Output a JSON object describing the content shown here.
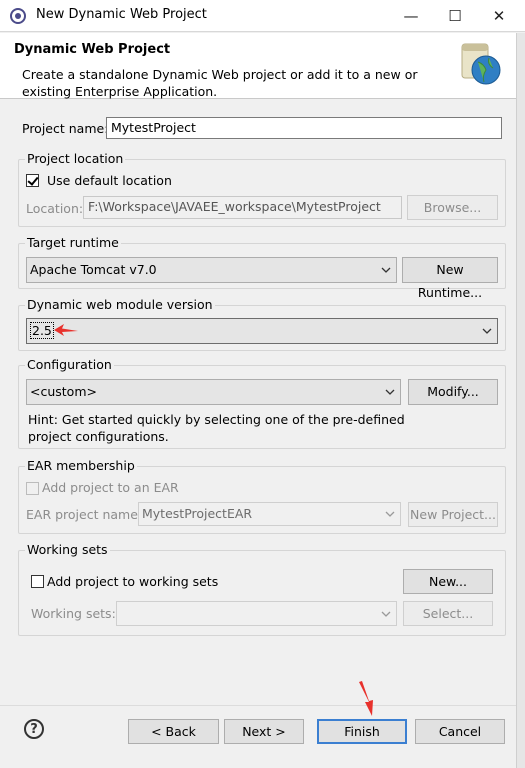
{
  "window": {
    "title": "New Dynamic Web Project",
    "minimize": "—",
    "maximize": "☐",
    "close": "✕"
  },
  "header": {
    "title": "Dynamic Web Project",
    "description": "Create a standalone Dynamic Web project or add it to a new or existing Enterprise Application."
  },
  "project_name": {
    "label": "Project name:",
    "value": "MytestProject"
  },
  "project_location": {
    "group_label": "Project location",
    "use_default_label": "Use default location",
    "use_default_checked": true,
    "location_label": "Location:",
    "location_value": "F:\\Workspace\\JAVAEE_workspace\\MytestProject",
    "browse_label": "Browse..."
  },
  "target_runtime": {
    "group_label": "Target runtime",
    "selected": "Apache Tomcat v7.0",
    "new_runtime_label": "New Runtime..."
  },
  "module_version": {
    "group_label": "Dynamic web module version",
    "selected": "2.5"
  },
  "configuration": {
    "group_label": "Configuration",
    "selected": "<custom>",
    "modify_label": "Modify...",
    "hint": "Hint: Get started quickly by selecting one of the pre-defined project configurations."
  },
  "ear": {
    "group_label": "EAR membership",
    "add_label": "Add project to an EAR",
    "name_label": "EAR project name:",
    "name_value": "MytestProjectEAR",
    "new_project_label": "New Project..."
  },
  "working_sets": {
    "group_label": "Working sets",
    "add_label": "Add project to working sets",
    "new_label": "New...",
    "sets_label": "Working sets:",
    "select_label": "Select..."
  },
  "footer": {
    "help": "?",
    "back": "< Back",
    "next": "Next >",
    "finish": "Finish",
    "cancel": "Cancel"
  },
  "colors": {
    "accent": "#3b7fd1",
    "arrow": "#e8312c"
  }
}
